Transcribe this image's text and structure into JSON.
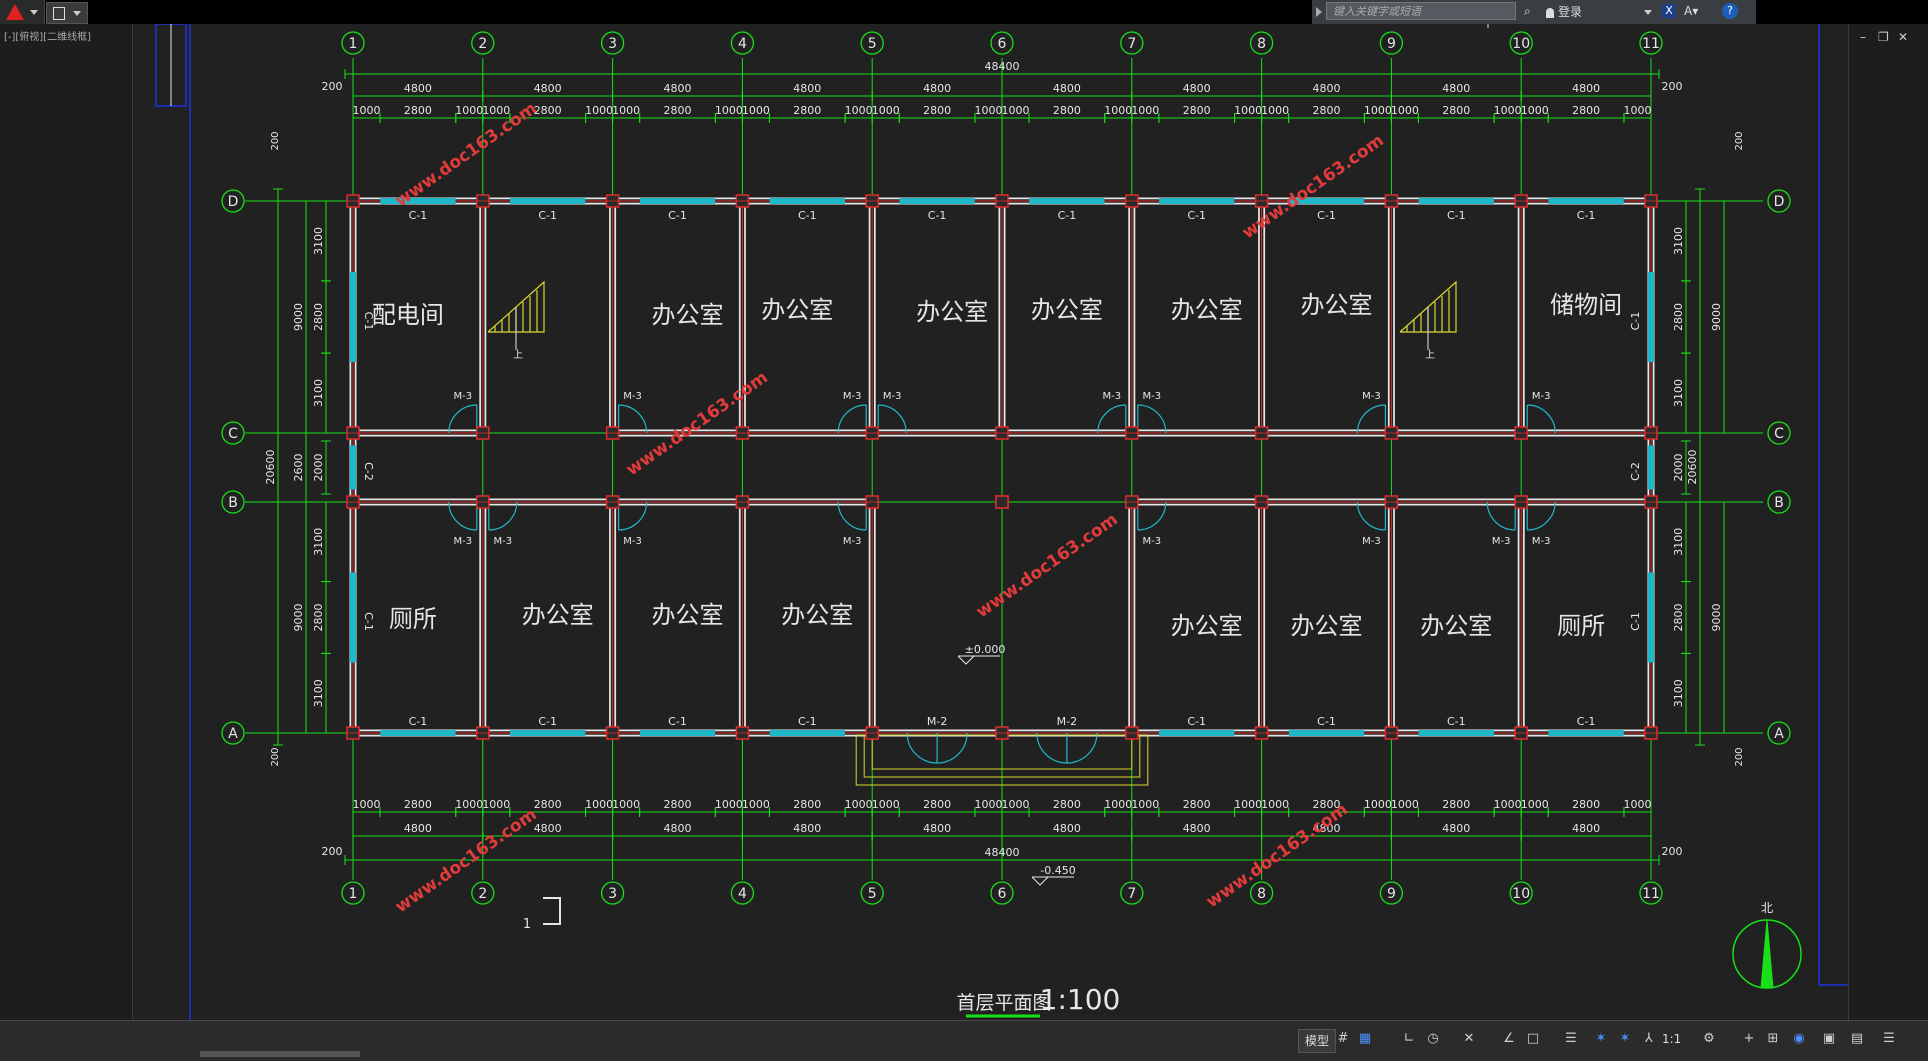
{
  "app": {
    "search_placeholder": "键入关键字或短语",
    "login_label": "登录",
    "viewport_label": "[-][俯视][二维线框]"
  },
  "statusbar": {
    "model_tab": "模型",
    "scale": "1:1"
  },
  "drawing": {
    "title": "首层平面图",
    "scale": "1:100",
    "north_label": "北",
    "section_mark": "1",
    "axes_numbers": [
      "1",
      "2",
      "3",
      "4",
      "5",
      "6",
      "7",
      "8",
      "9",
      "10",
      "11"
    ],
    "axes_letters": [
      "D",
      "C",
      "B",
      "A"
    ],
    "total_length": "48400",
    "total_width": "20600",
    "edge_offset": "200",
    "bay_width": "4800",
    "opening_segments": [
      "1000",
      "2800",
      "1000"
    ],
    "left_dims": {
      "upper_total": "9000",
      "upper_parts": [
        "3100",
        "2800",
        "3100"
      ],
      "corridor": "2600",
      "corridor_part": "2000",
      "lower_total": "9000",
      "lower_parts": [
        "3100",
        "2800",
        "3100"
      ]
    },
    "rooms_north": [
      "配电间",
      "办公室",
      "办公室",
      "办公室",
      "办公室",
      "办公室",
      "办公室",
      "储物间"
    ],
    "rooms_south": [
      "厕所",
      "办公室",
      "办公室",
      "办公室",
      "办公室",
      "办公室",
      "办公室",
      "厕所"
    ],
    "window_label": "C-1",
    "window_label_2": "C-2",
    "door_label": "M-3",
    "entrance_door_label": "M-2",
    "level_main": "±0.000",
    "level_outside": "-0.450",
    "stair_mark": "上",
    "watermark": "www.doc163.com"
  }
}
